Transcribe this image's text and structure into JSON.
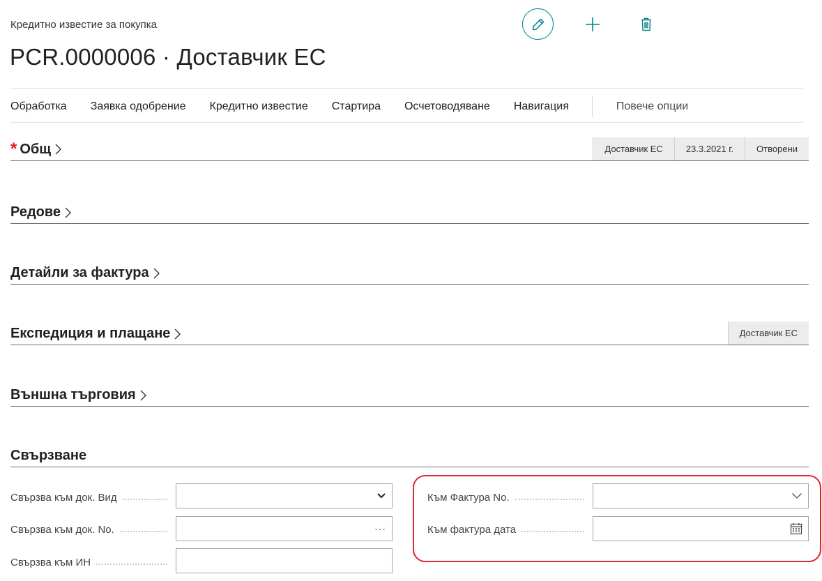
{
  "header": {
    "caption": "Кредитно известие за покупка",
    "title": "PCR.0000006 · Доставчик ЕС",
    "icons": {
      "edit": "pencil-icon",
      "new": "plus-icon",
      "delete": "trash-icon"
    },
    "accent_color": "#00818a"
  },
  "actions": {
    "items": [
      "Обработка",
      "Заявка одобрение",
      "Кредитно известие",
      "Стартира",
      "Осчетоводяване",
      "Навигация"
    ],
    "more": "Повече опции"
  },
  "sections": {
    "general": {
      "title": "Общ",
      "required": "*",
      "chips": [
        "Доставчик ЕС",
        "23.3.2021 г.",
        "Отворени"
      ]
    },
    "lines": {
      "title": "Редове"
    },
    "invoice_details": {
      "title": "Детайли за фактура"
    },
    "shipping": {
      "title": "Експедиция и плащане",
      "chips": [
        "Доставчик ЕС"
      ]
    },
    "foreign_trade": {
      "title": "Външна търговия"
    },
    "linking": {
      "title": "Свързване"
    }
  },
  "fields": {
    "link_doc_type": {
      "label": "Свързва към док. Вид",
      "value": ""
    },
    "link_doc_no": {
      "label": "Свързва към док. No.",
      "value": "",
      "button": "···"
    },
    "link_vat": {
      "label": "Свързва към ИН",
      "value": ""
    },
    "to_invoice_no": {
      "label": "Към Фактура No.",
      "value": ""
    },
    "to_invoice_date": {
      "label": "Към фактура дата",
      "value": ""
    }
  },
  "highlight_color": "#e0262f"
}
